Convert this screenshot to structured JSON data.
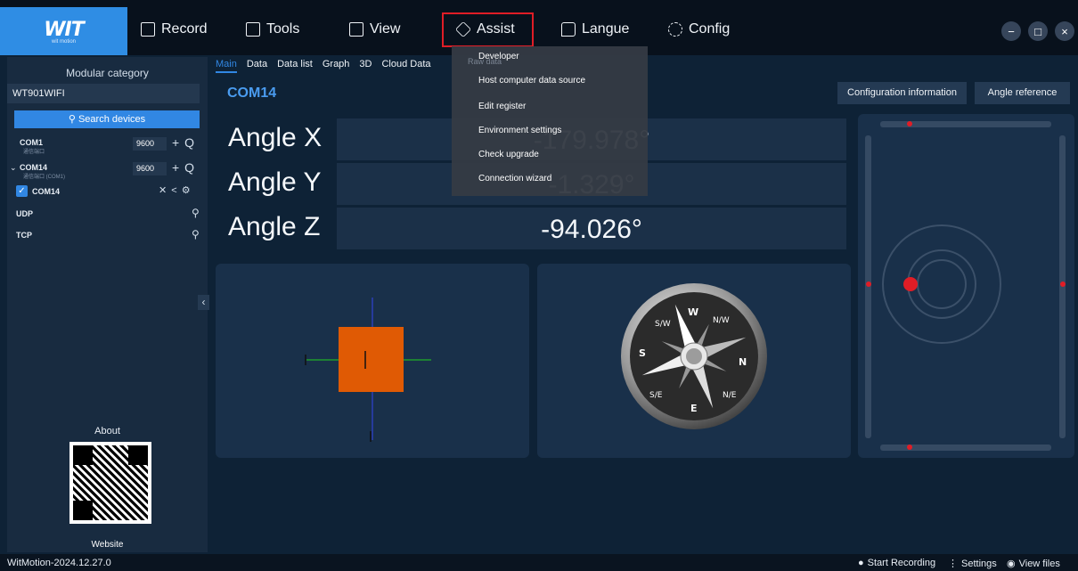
{
  "app": {
    "logo_text": "WIT",
    "logo_sub": "wit motion",
    "version": "WitMotion-2024.12.27.0"
  },
  "menu": [
    {
      "label": "Record",
      "icon": "folder-icon"
    },
    {
      "label": "Tools",
      "icon": "toolbox-icon"
    },
    {
      "label": "View",
      "icon": "chart-icon"
    },
    {
      "label": "Assist",
      "icon": "cube-icon"
    },
    {
      "label": "Langue",
      "icon": "language-icon"
    },
    {
      "label": "Config",
      "icon": "gear-icon"
    }
  ],
  "window_controls": {
    "minimize": "−",
    "restore": "□",
    "close": "×"
  },
  "sidebar": {
    "title": "Modular category",
    "module": "WT901WIFI",
    "search_label": "Search devices",
    "devices": [
      {
        "name": "COM1",
        "sub": "通信端口",
        "baud": "9600",
        "actions": "+ Q"
      },
      {
        "name": "COM14",
        "sub": "通信端口 (COM1)",
        "baud": "9600",
        "actions": "+ Q"
      }
    ],
    "connected": {
      "name": "COM14",
      "actions": "✕ < ⚙"
    },
    "udp": "UDP",
    "tcp": "TCP",
    "about": "About",
    "website": "Website"
  },
  "tabs": [
    "Main",
    "Data",
    "Data list",
    "Graph",
    "3D",
    "Cloud Data",
    "Raw data"
  ],
  "main": {
    "port": "COM14",
    "config_btn": "Configuration information",
    "angle_ref_btn": "Angle reference",
    "angles": [
      {
        "label": "Angle X",
        "value": "-179.978°"
      },
      {
        "label": "Angle Y",
        "value": "-1.329°"
      },
      {
        "label": "Angle Z",
        "value": "-94.026°"
      }
    ]
  },
  "assist_menu": {
    "items": [
      "Developer",
      "Host computer data source",
      "Edit register",
      "Environment settings",
      "Check upgrade",
      "Connection wizard"
    ]
  },
  "compass": {
    "labels": [
      "W",
      "N/W",
      "N",
      "N/E",
      "E",
      "S/E",
      "S",
      "S/W"
    ]
  },
  "status": {
    "start_recording": "Start Recording",
    "settings": "Settings",
    "view_files": "View files"
  },
  "colors": {
    "accent": "#3187e3",
    "highlight_box": "#e01d26",
    "cube": "#e05a04"
  }
}
